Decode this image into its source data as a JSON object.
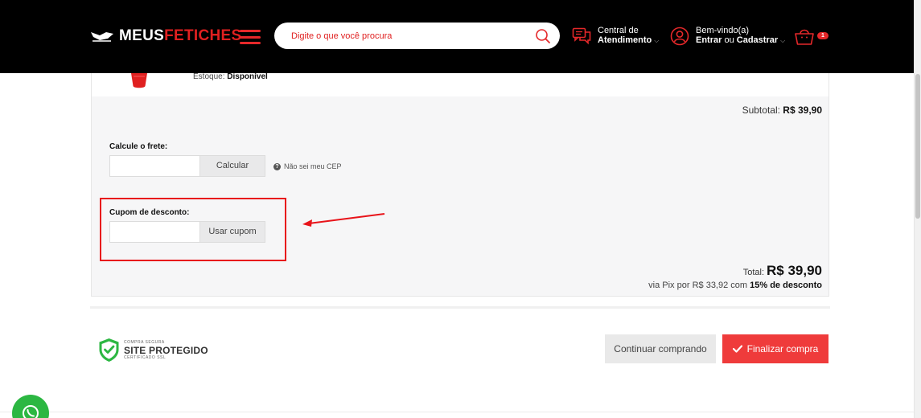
{
  "header": {
    "logo_part1": "MEUS",
    "logo_part2": "FETICHES",
    "search_placeholder": "Digite o que você procura",
    "central_line1": "Central de",
    "central_line2": "Atendimento",
    "account_line1": "Bem-vindo(a)",
    "account_enter": "Entrar",
    "account_or": "ou",
    "account_register": "Cadastrar",
    "cart_count": "1"
  },
  "product": {
    "stock_label": "Estoque:",
    "stock_value": "Disponível"
  },
  "summary": {
    "subtotal_label": "Subtotal:",
    "subtotal_value": "R$ 39,90",
    "frete_label": "Calcule o frete:",
    "frete_button": "Calcular",
    "cep_help": "Não sei meu CEP",
    "cupom_label": "Cupom de desconto:",
    "cupom_button": "Usar cupom",
    "total_label": "Total:",
    "total_value": "R$ 39,90",
    "pix_prefix": "via Pix por",
    "pix_value": "R$ 33,92",
    "pix_with": "com",
    "pix_discount": "15% de desconto"
  },
  "footer": {
    "seal_top": "COMPRA SEGURA",
    "seal_main": "SITE PROTEGIDO",
    "seal_bottom": "CERTIFICADO SSL",
    "continue_button": "Continuar comprando",
    "finish_button": "Finalizar compra"
  },
  "colors": {
    "brand_red": "#e5282a",
    "button_red": "#ef3b3b",
    "highlight_red": "#e8141a",
    "header_bg": "#000000",
    "whatsapp_green": "#2cb742"
  },
  "icons": [
    "menu-icon",
    "search-icon",
    "chat-icon",
    "user-icon",
    "cart-icon",
    "help-icon",
    "check-icon",
    "shield-icon",
    "whatsapp-icon"
  ]
}
